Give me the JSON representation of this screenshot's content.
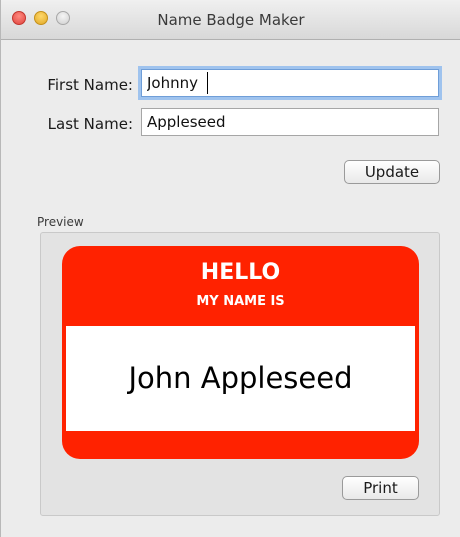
{
  "window": {
    "title": "Name Badge Maker"
  },
  "form": {
    "first_name_label": "First Name:",
    "first_name_value": "Johnny",
    "last_name_label": "Last Name:",
    "last_name_value": "Appleseed",
    "update_label": "Update"
  },
  "preview": {
    "label": "Preview",
    "badge": {
      "hello": "HELLO",
      "my_name_is": "MY NAME IS",
      "name": "John Appleseed",
      "color": "#ff2200"
    },
    "print_label": "Print"
  }
}
